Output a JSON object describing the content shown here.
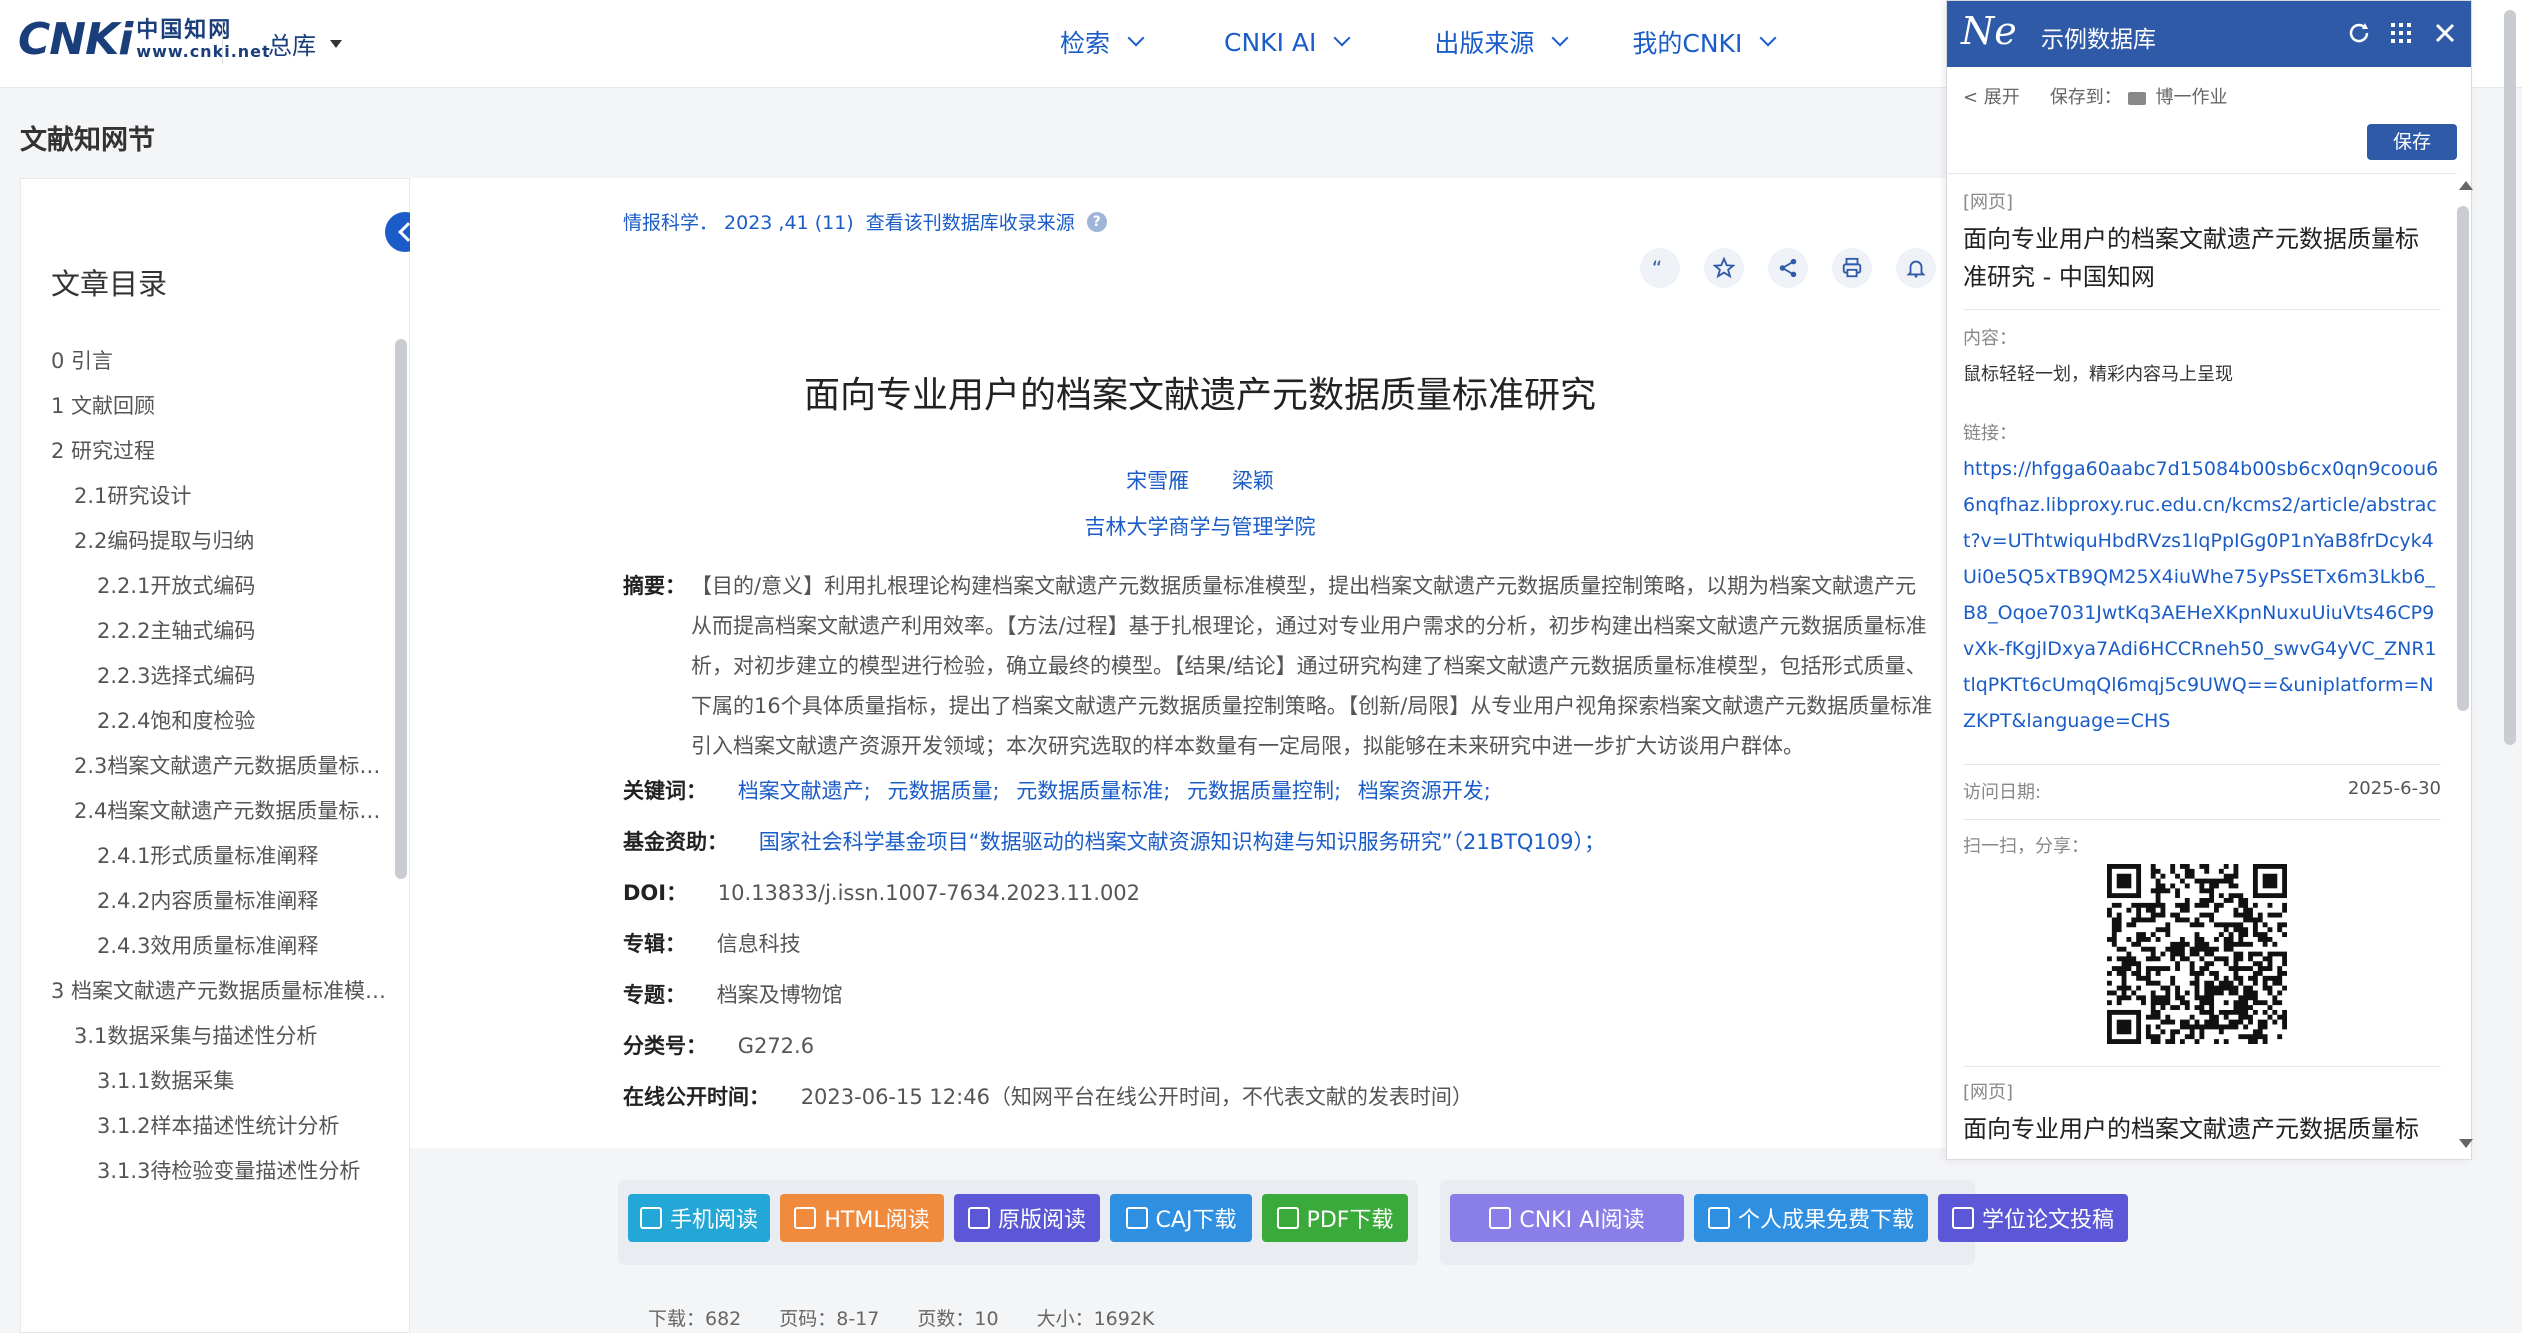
{
  "header": {
    "logo_text": "CNKi",
    "logo_cn": "中国知网",
    "logo_url": "www.cnki.net",
    "library_select": "总库",
    "nav": [
      "检索",
      "CNKI AI",
      "出版来源",
      "我的CNKI"
    ]
  },
  "page_title": "文献知网节",
  "toc": {
    "title": "文章目录",
    "items": [
      {
        "label": "0 引言",
        "level": 1
      },
      {
        "label": "1 文献回顾",
        "level": 1
      },
      {
        "label": "2 研究过程",
        "level": 1
      },
      {
        "label": "2.1研究设计",
        "level": 2
      },
      {
        "label": "2.2编码提取与归纳",
        "level": 2
      },
      {
        "label": "2.2.1开放式编码",
        "level": 3
      },
      {
        "label": "2.2.2主轴式编码",
        "level": 3
      },
      {
        "label": "2.2.3选择式编码",
        "level": 3
      },
      {
        "label": "2.2.4饱和度检验",
        "level": 3
      },
      {
        "label": "2.3档案文献遗产元数据质量标准...",
        "level": 2
      },
      {
        "label": "2.4档案文献遗产元数据质量标准...",
        "level": 2
      },
      {
        "label": "2.4.1形式质量标准阐释",
        "level": 3
      },
      {
        "label": "2.4.2内容质量标准阐释",
        "level": 3
      },
      {
        "label": "2.4.3效用质量标准阐释",
        "level": 3
      },
      {
        "label": "3 档案文献遗产元数据质量标准模型...",
        "level": 1
      },
      {
        "label": "3.1数据采集与描述性分析",
        "level": 2
      },
      {
        "label": "3.1.1数据采集",
        "level": 3
      },
      {
        "label": "3.1.2样本描述性统计分析",
        "level": 3
      },
      {
        "label": "3.1.3待检验变量描述性分析",
        "level": 3
      }
    ]
  },
  "article": {
    "source": "情报科学． 2023 ,41 (11)",
    "source_link": "查看该刊数据库收录来源",
    "title": "面向专业用户的档案文献遗产元数据质量标准研究",
    "authors": [
      "宋雪雁",
      "梁颖"
    ],
    "affiliation": "吉林大学商学与管理学院",
    "abstract_label": "摘要：",
    "abstract": "【目的/意义】利用扎根理论构建档案文献遗产元数据质量标准模型，提出档案文献遗产元数据质量控制策略，以期为档案文献遗产元\n从而提高档案文献遗产利用效率。【方法/过程】基于扎根理论，通过对专业用户需求的分析，初步构建出档案文献遗产元数据质量标准\n析，对初步建立的模型进行检验，确立最终的模型。【结果/结论】通过研究构建了档案文献遗产元数据质量标准模型，包括形式质量、\n下属的16个具体质量指标，提出了档案文献遗产元数据质量控制策略。【创新/局限】从专业用户视角探索档案文献遗产元数据质量标准\n引入档案文献遗产资源开发领域；本次研究选取的样本数量有一定局限，拟能够在未来研究中进一步扩大访谈用户群体。",
    "keywords_label": "关键词：",
    "keywords": [
      "档案文献遗产;",
      "元数据质量;",
      "元数据质量标准;",
      "元数据质量控制;",
      "档案资源开发;"
    ],
    "fund_label": "基金资助：",
    "fund": "国家社会科学基金项目“数据驱动的档案文献资源知识构建与知识服务研究”（21BTQ109）；",
    "doi_label": "DOI：",
    "doi": "10.13833/j.issn.1007-7634.2023.11.002",
    "series_label": "专辑：",
    "series": "信息科技",
    "topic_label": "专题：",
    "topic": "档案及博物馆",
    "class_label": "分类号：",
    "class_no": "G272.6",
    "online_label": "在线公开时间：",
    "online": "2023-06-15 12:46（知网平台在线公开时间，不代表文献的发表时间）"
  },
  "actions": {
    "group1": [
      {
        "label": "手机阅读",
        "color": "#22a7d6"
      },
      {
        "label": "HTML阅读",
        "color": "#f08a3c"
      },
      {
        "label": "原版阅读",
        "color": "#5b57d6"
      },
      {
        "label": "CAJ下载",
        "color": "#2f8fe0"
      },
      {
        "label": "PDF下载",
        "color": "#3aaa3a"
      }
    ],
    "group2": [
      {
        "label": "CNKI AI阅读",
        "color": "#8a7ee8"
      },
      {
        "label": "个人成果免费下载",
        "color": "#2f8fe0"
      },
      {
        "label": "学位论文投稿",
        "color": "#5b57d6"
      }
    ]
  },
  "stats": [
    "下载：682",
    "页码：8-17",
    "页数：10",
    "大小：1692K"
  ],
  "panel": {
    "logo": "Ne",
    "name": "示例数据库",
    "expand": "< 展开",
    "save_to": "保存到：",
    "folder": "博一作业",
    "save_button": "保存",
    "entry_tag": "[网页]",
    "entry_title": "面向专业用户的档案文献遗产元数据质量标准研究 - 中国知网",
    "content_label": "内容：",
    "content": "鼠标轻轻一划，精彩内容马上呈现",
    "link_label": "链接：",
    "link": "https://hfgga60aabc7d15084b00sb6cx0qn9coou66nqfhaz.libproxy.ruc.edu.cn/kcms2/article/abstract?v=UThtwiquHbdRVzs1lqPpIGg0P1nYaB8frDcyk4Ui0e5Q5xTB9QM25X4iuWhe75yPsSETx6m3Lkb6_B8_Oqoe7031JwtKq3AEHeXKpnNuxuUiuVts46CP9vXk-fKgjIDxya7Adi6HCCRneh50_swvG4yVC_ZNR1tlqPKTt6cUmqQl6mqj5c9UWQ==&uniplatform=NZKPT&language=CHS",
    "visit_label": "访问日期:",
    "visit_date": "2025-6-30",
    "share_label": "扫一扫，分享：",
    "entry2_tag": "[网页]",
    "entry2_title": "面向专业用户的档案文献遗产元数据质量标"
  }
}
